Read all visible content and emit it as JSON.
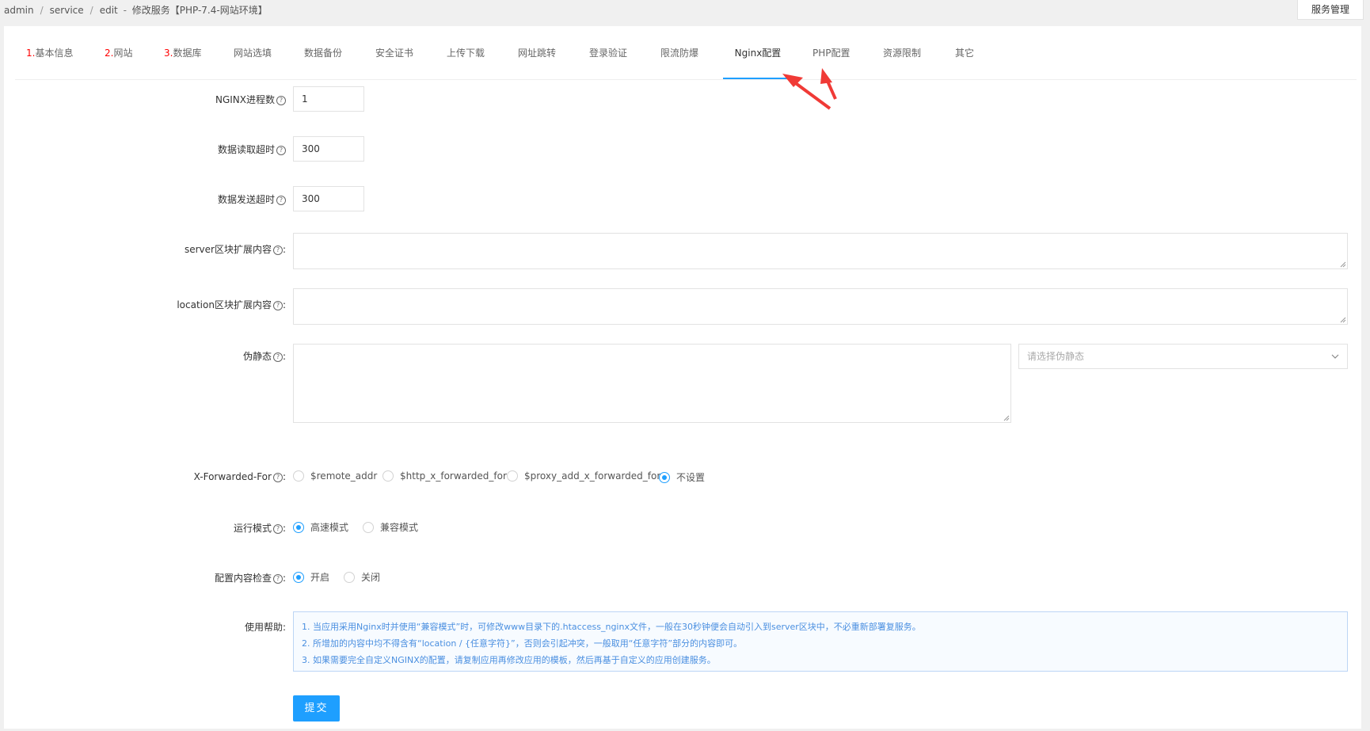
{
  "breadcrumb": {
    "items": [
      "admin",
      "service",
      "edit"
    ],
    "title": "修改服务【PHP-7.4-网站环境】"
  },
  "top_button": "服务管理",
  "tabs": [
    {
      "num": "1.",
      "label": "基本信息"
    },
    {
      "num": "2.",
      "label": "网站"
    },
    {
      "num": "3.",
      "label": "数据库"
    },
    {
      "num": "",
      "label": "网站选填"
    },
    {
      "num": "",
      "label": "数据备份"
    },
    {
      "num": "",
      "label": "安全证书"
    },
    {
      "num": "",
      "label": "上传下载"
    },
    {
      "num": "",
      "label": "网址跳转"
    },
    {
      "num": "",
      "label": "登录验证"
    },
    {
      "num": "",
      "label": "限流防爆"
    },
    {
      "num": "",
      "label": "Nginx配置"
    },
    {
      "num": "",
      "label": "PHP配置"
    },
    {
      "num": "",
      "label": "资源限制"
    },
    {
      "num": "",
      "label": "其它"
    }
  ],
  "active_tab": "Nginx配置",
  "form": {
    "nginx_workers": {
      "label": "NGINX进程数",
      "value": "1"
    },
    "read_timeout": {
      "label": "数据读取超时",
      "value": "300"
    },
    "send_timeout": {
      "label": "数据发送超时",
      "value": "300"
    },
    "server_ext": {
      "label": "server区块扩展内容",
      "suffix": ":"
    },
    "location_ext": {
      "label": "location区块扩展内容",
      "suffix": ":"
    },
    "rewrite": {
      "label": "伪静态",
      "suffix": ":",
      "select_placeholder": "请选择伪静态"
    },
    "xff": {
      "label": "X-Forwarded-For",
      "suffix": ":",
      "options": [
        "$remote_addr",
        "$http_x_forwarded_for",
        "$proxy_add_x_forwarded_for",
        "不设置"
      ],
      "selected": "不设置"
    },
    "run_mode": {
      "label": "运行模式",
      "suffix": ":",
      "options": [
        "高速模式",
        "兼容模式"
      ],
      "selected": "高速模式"
    },
    "config_check": {
      "label": "配置内容检查",
      "suffix": ":",
      "options": [
        "开启",
        "关闭"
      ],
      "selected": "开启"
    },
    "help": {
      "label": "使用帮助",
      "suffix": ":",
      "lines": [
        "1. 当应用采用Nginx时并使用“兼容模式”时，可修改www目录下的.htaccess_nginx文件，一般在30秒钟便会自动引入到server区块中，不必重新部署复服务。",
        "2. 所增加的内容中均不得含有“location / {任意字符}”，否则会引起冲突，一般取用“任意字符”部分的内容即可。",
        "3. 如果需要完全自定义NGINX的配置，请复制应用再修改应用的模板，然后再基于自定义的应用创建服务。"
      ]
    }
  },
  "submit_label": "提交",
  "colors": {
    "accent": "#1e9fff",
    "tab_number": "#ff0000",
    "annotation_arrow": "#f03a36"
  }
}
